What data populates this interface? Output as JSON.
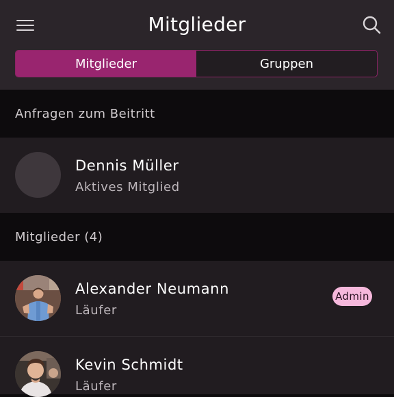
{
  "header": {
    "title": "Mitglieder",
    "menu_icon": "hamburger-menu-icon",
    "search_icon": "search-icon"
  },
  "tabs": [
    {
      "label": "Mitglieder",
      "active": true
    },
    {
      "label": "Gruppen",
      "active": false
    }
  ],
  "requests": {
    "heading": "Anfragen zum Beitritt",
    "items": [
      {
        "name": "Dennis Müller",
        "subtitle": "Aktives Mitglied",
        "avatar": "placeholder"
      }
    ]
  },
  "members": {
    "heading": "Mitglieder (4)",
    "items": [
      {
        "name": "Alexander Neumann",
        "subtitle": "Läufer",
        "badge": "Admin",
        "avatar": "photo"
      },
      {
        "name": "Kevin Schmidt",
        "subtitle": "Läufer",
        "avatar": "photo"
      }
    ]
  },
  "colors": {
    "accent": "#99256f",
    "badge_bg": "#f6b8dc",
    "header_bg": "#2b252a",
    "row_bg": "#211c20",
    "section_bg": "#0d0b0d"
  }
}
